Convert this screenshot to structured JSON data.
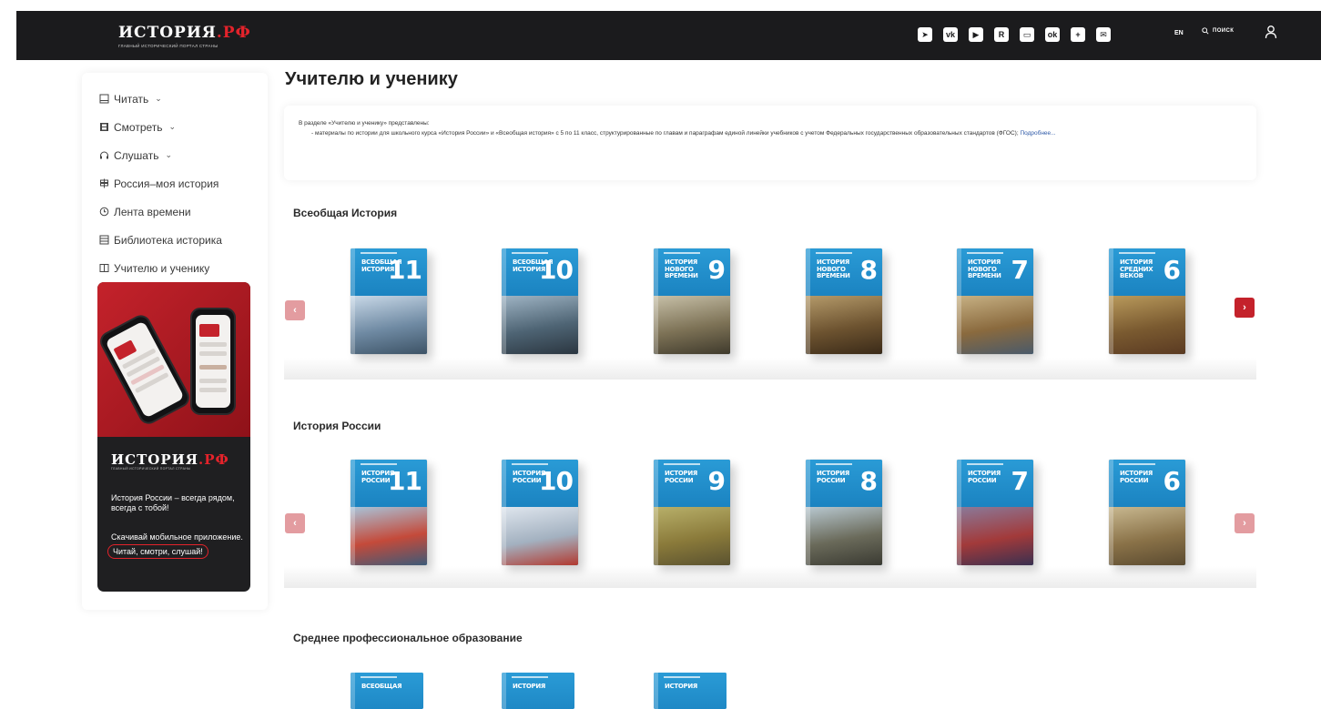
{
  "header": {
    "logo_main": "ИСТОРИЯ",
    "logo_rf": ".РФ",
    "logo_sub": "главный исторический портал страны",
    "socials": [
      "telegram-icon",
      "vk-icon",
      "dzen-icon",
      "rutube-icon",
      "video-icon",
      "ok-icon",
      "plus-icon",
      "mail-icon"
    ],
    "lang": "EN",
    "search_label": "ПОИСК"
  },
  "sidebar": {
    "items": [
      {
        "label": "Читать",
        "icon": "book-icon",
        "has_chevron": true
      },
      {
        "label": "Смотреть",
        "icon": "film-icon",
        "has_chevron": true
      },
      {
        "label": "Слушать",
        "icon": "headphones-icon",
        "has_chevron": true
      },
      {
        "label": "Россия–моя история",
        "icon": "signpost-icon",
        "has_chevron": false
      },
      {
        "label": "Лента времени",
        "icon": "clock-icon",
        "has_chevron": false
      },
      {
        "label": "Библиотека историка",
        "icon": "library-icon",
        "has_chevron": false
      },
      {
        "label": "Учителю и ученику",
        "icon": "open-book-icon",
        "has_chevron": false
      }
    ],
    "chevron": "⌄"
  },
  "promo": {
    "logo_main": "ИСТОРИЯ",
    "logo_rf": ".РФ",
    "logo_sub": "главный исторический портал страны",
    "line1": "История России – всегда рядом,",
    "line2": "всегда с тобой!",
    "line3": "Скачивай мобильное приложение.",
    "cta": "Читай, смотри, слушай!"
  },
  "main": {
    "title": "Учителю и ученику",
    "intro_lead": "В разделе «Учителю и ученику» представлены:",
    "intro_bullet": "- материалы по истории для школьного курса «История России» и «Всеобщая история» с 5 по 11 класс, структурированные по главам и параграфам единой линейки учебников с учетом Федеральных государственных образовательных стандартов (ФГОС);",
    "intro_more": "Подробнее..."
  },
  "sections": [
    {
      "title": "Всеобщая История",
      "prev": "‹",
      "next": "›",
      "books": [
        {
          "title": "ВСЕОБЩАЯ ИСТОРИЯ",
          "grade": "11",
          "art": [
            "#c9d9e8",
            "#6f8aa3",
            "#3d5366"
          ]
        },
        {
          "title": "ВСЕОБЩАЯ ИСТОРИЯ",
          "grade": "10",
          "art": [
            "#9fb4c4",
            "#4e6474",
            "#2b3640"
          ]
        },
        {
          "title": "ИСТОРИЯ НОВОГО ВРЕМЕНИ",
          "grade": "9",
          "art": [
            "#c7c0a8",
            "#7d7256",
            "#3f3a2c"
          ]
        },
        {
          "title": "ИСТОРИЯ НОВОГО ВРЕМЕНИ",
          "grade": "8",
          "art": [
            "#b49a6a",
            "#6d5330",
            "#3a2a18"
          ]
        },
        {
          "title": "ИСТОРИЯ НОВОГО ВРЕМЕНИ",
          "grade": "7",
          "art": [
            "#c7b184",
            "#8a6a3e",
            "#4a5a6a"
          ]
        },
        {
          "title": "ИСТОРИЯ СРЕДНИХ ВЕКОВ",
          "grade": "6",
          "art": [
            "#b99a5c",
            "#7a5a30",
            "#5a3a22"
          ]
        }
      ]
    },
    {
      "title": "История России",
      "prev": "‹",
      "next": "›",
      "books": [
        {
          "title": "ИСТОРИЯ РОССИИ",
          "grade": "11",
          "art": [
            "#a8c4da",
            "#c44a3a",
            "#3d5a78"
          ]
        },
        {
          "title": "ИСТОРИЯ РОССИИ",
          "grade": "10",
          "art": [
            "#dfe6ee",
            "#a3b1c0",
            "#b23a30"
          ]
        },
        {
          "title": "ИСТОРИЯ РОССИИ",
          "grade": "9",
          "art": [
            "#b8b06a",
            "#8a7a3a",
            "#5a5230"
          ]
        },
        {
          "title": "ИСТОРИЯ РОССИИ",
          "grade": "8",
          "art": [
            "#b8c8d0",
            "#6a6a5a",
            "#3a3a32"
          ]
        },
        {
          "title": "ИСТОРИЯ РОССИИ",
          "grade": "7",
          "art": [
            "#8a7a9a",
            "#a23a3a",
            "#3a3050"
          ]
        },
        {
          "title": "ИСТОРИЯ РОССИИ",
          "grade": "6",
          "art": [
            "#c8b890",
            "#8a7248",
            "#5a4a30"
          ]
        }
      ]
    },
    {
      "title": "Среднее профессиональное образование",
      "books": [
        {
          "title": "ВСЕОБЩАЯ",
          "grade": ""
        },
        {
          "title": "ИСТОРИЯ",
          "grade": ""
        },
        {
          "title": "ИСТОРИЯ",
          "grade": ""
        }
      ]
    }
  ]
}
